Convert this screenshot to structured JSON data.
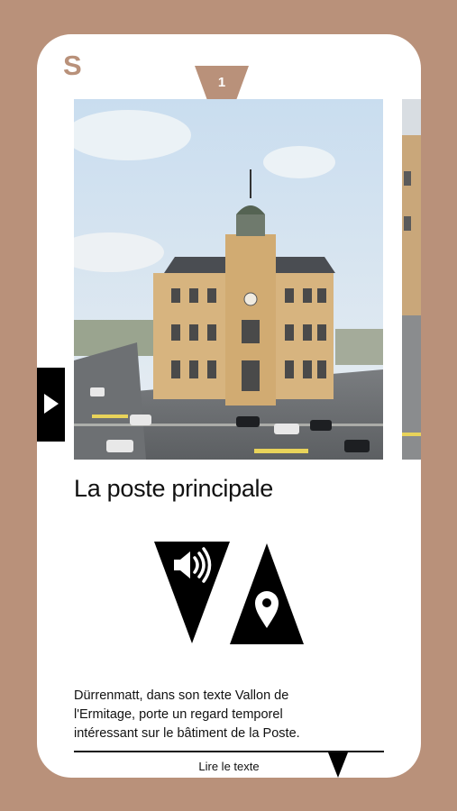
{
  "app": {
    "logo_letter": "S"
  },
  "card": {
    "index": "1",
    "title": "La poste principale",
    "description": "Dürrenmatt, dans son texte Vallon de l'Ermitage, porte un regard temporel intéressant sur le bâtiment de la Poste.",
    "read_text_label": "Lire le texte"
  },
  "icons": {
    "side_tab": "play-arrow-icon",
    "audio": "speaker-icon",
    "map": "map-pin-icon",
    "more": "chevron-down-icon"
  },
  "colors": {
    "background": "#b9917a",
    "card": "#ffffff",
    "accent": "#b9917a",
    "text": "#111111"
  }
}
